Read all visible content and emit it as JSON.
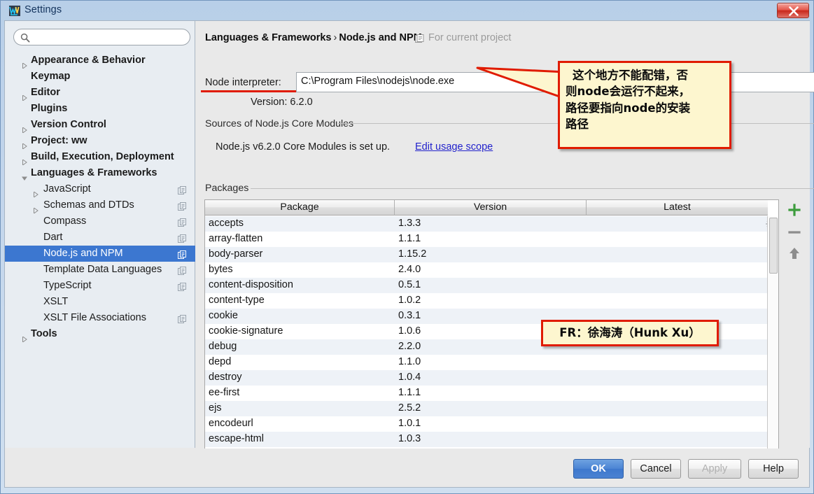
{
  "window": {
    "title": "Settings",
    "logo_icon": "webstorm-logo-icon",
    "close_label": "close-window"
  },
  "sidebar": {
    "search": {
      "value": "",
      "placeholder": "",
      "icon": "search-icon"
    },
    "items": [
      {
        "label": "Appearance & Behavior",
        "level": 0,
        "expandable": true,
        "expanded": false,
        "copy": false,
        "selected": false
      },
      {
        "label": "Keymap",
        "level": 0,
        "expandable": false,
        "expanded": false,
        "copy": false,
        "selected": false
      },
      {
        "label": "Editor",
        "level": 0,
        "expandable": true,
        "expanded": false,
        "copy": false,
        "selected": false
      },
      {
        "label": "Plugins",
        "level": 0,
        "expandable": false,
        "expanded": false,
        "copy": false,
        "selected": false
      },
      {
        "label": "Version Control",
        "level": 0,
        "expandable": true,
        "expanded": false,
        "copy": false,
        "selected": false
      },
      {
        "label": "Project: ww",
        "level": 0,
        "expandable": true,
        "expanded": false,
        "copy": false,
        "selected": false
      },
      {
        "label": "Build, Execution, Deployment",
        "level": 0,
        "expandable": true,
        "expanded": false,
        "copy": false,
        "selected": false
      },
      {
        "label": "Languages & Frameworks",
        "level": 0,
        "expandable": true,
        "expanded": true,
        "copy": false,
        "selected": false
      },
      {
        "label": "JavaScript",
        "level": 1,
        "expandable": true,
        "expanded": false,
        "copy": true,
        "selected": false
      },
      {
        "label": "Schemas and DTDs",
        "level": 1,
        "expandable": true,
        "expanded": false,
        "copy": true,
        "selected": false
      },
      {
        "label": "Compass",
        "level": 1,
        "expandable": false,
        "expanded": false,
        "copy": true,
        "selected": false
      },
      {
        "label": "Dart",
        "level": 1,
        "expandable": false,
        "expanded": false,
        "copy": true,
        "selected": false
      },
      {
        "label": "Node.js and NPM",
        "level": 1,
        "expandable": false,
        "expanded": false,
        "copy": true,
        "selected": true
      },
      {
        "label": "Template Data Languages",
        "level": 1,
        "expandable": false,
        "expanded": false,
        "copy": true,
        "selected": false
      },
      {
        "label": "TypeScript",
        "level": 1,
        "expandable": false,
        "expanded": false,
        "copy": true,
        "selected": false
      },
      {
        "label": "XSLT",
        "level": 1,
        "expandable": false,
        "expanded": false,
        "copy": false,
        "selected": false
      },
      {
        "label": "XSLT File Associations",
        "level": 1,
        "expandable": false,
        "expanded": false,
        "copy": true,
        "selected": false
      },
      {
        "label": "Tools",
        "level": 0,
        "expandable": true,
        "expanded": false,
        "copy": false,
        "selected": false
      }
    ]
  },
  "main": {
    "breadcrumb_parent": "Languages & Frameworks",
    "breadcrumb_sep": "›",
    "breadcrumb_current": "Node.js and NPM",
    "scope_note": "For current project",
    "scope_icon": "module-scope-icon",
    "node_interpreter_label": "Node interpreter:",
    "node_interpreter_value": "C:\\Program Files\\nodejs\\node.exe",
    "dropdown_icon": "chevron-down-icon",
    "browse_label": "...",
    "version_line": "Version: 6.2.0",
    "sources_group_title": "Sources of Node.js Core Modules",
    "core_modules_status": "Node.js v6.2.0 Core Modules is set up.",
    "edit_usage_scope_link": "Edit usage scope",
    "packages_group_title": "Packages"
  },
  "packages_table": {
    "columns": [
      "Package",
      "Version",
      "Latest"
    ],
    "rows": [
      {
        "package": "accepts",
        "version": "1.3.3",
        "latest": "",
        "loading": true
      },
      {
        "package": "array-flatten",
        "version": "1.1.1",
        "latest": "",
        "loading": false
      },
      {
        "package": "body-parser",
        "version": "1.15.2",
        "latest": "",
        "loading": false
      },
      {
        "package": "bytes",
        "version": "2.4.0",
        "latest": "",
        "loading": false
      },
      {
        "package": "content-disposition",
        "version": "0.5.1",
        "latest": "",
        "loading": false
      },
      {
        "package": "content-type",
        "version": "1.0.2",
        "latest": "",
        "loading": false
      },
      {
        "package": "cookie",
        "version": "0.3.1",
        "latest": "",
        "loading": false
      },
      {
        "package": "cookie-signature",
        "version": "1.0.6",
        "latest": "",
        "loading": false
      },
      {
        "package": "debug",
        "version": "2.2.0",
        "latest": "",
        "loading": false
      },
      {
        "package": "depd",
        "version": "1.1.0",
        "latest": "",
        "loading": false
      },
      {
        "package": "destroy",
        "version": "1.0.4",
        "latest": "",
        "loading": false
      },
      {
        "package": "ee-first",
        "version": "1.1.1",
        "latest": "",
        "loading": false
      },
      {
        "package": "ejs",
        "version": "2.5.2",
        "latest": "",
        "loading": false
      },
      {
        "package": "encodeurl",
        "version": "1.0.1",
        "latest": "",
        "loading": false
      },
      {
        "package": "escape-html",
        "version": "1.0.3",
        "latest": "",
        "loading": false
      }
    ],
    "tools": [
      {
        "name": "add-package-button",
        "icon": "plus-icon",
        "color": "#3c9c3c"
      },
      {
        "name": "remove-package-button",
        "icon": "minus-icon",
        "color": "#8d8d8d"
      },
      {
        "name": "upgrade-package-button",
        "icon": "arrow-up-icon",
        "color": "#8d8d8d"
      }
    ]
  },
  "footer": {
    "ok": "OK",
    "cancel": "Cancel",
    "apply": "Apply",
    "help": "Help"
  },
  "annotations": {
    "callout1_lines": [
      "这个地方不能配错，否",
      "则node会运行不起来，",
      "路径要指向node的安装",
      "路径"
    ],
    "callout2_text": "FR：徐海涛（Hunk Xu）",
    "highlight_color": "#e01b00",
    "callout_fill": "#fdf6cf"
  }
}
